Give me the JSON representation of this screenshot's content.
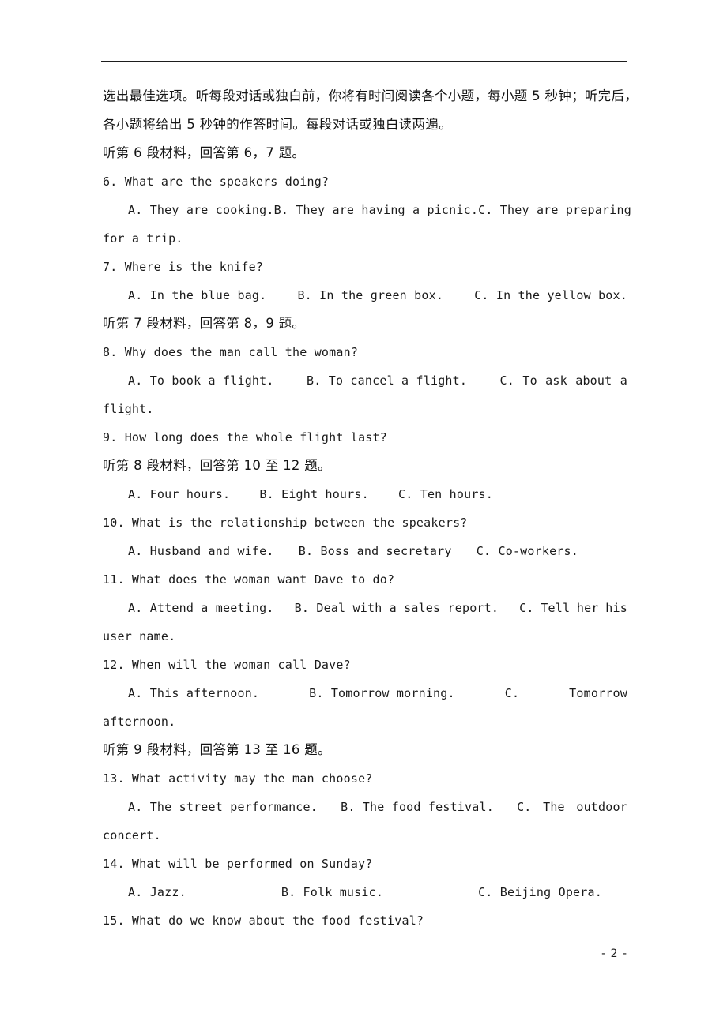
{
  "page": {
    "footer_page_number": "- 2 -",
    "rule_color": "#1d1d1d"
  },
  "instructions": {
    "line1_left": "选出最佳选项。听每段对话或独白前，你将有时间阅读各个小题，每小题 5 秒钟；听完后，",
    "line2": "各小题将给出 5 秒钟的作答时间。每段对话或独白读两遍。"
  },
  "sections": [
    {
      "id": "sec6",
      "label": "听第 6 段材料，回答第 6，7 题。"
    },
    {
      "id": "sec7",
      "label": "听第 7 段材料，回答第 8，9 题。"
    },
    {
      "id": "sec8",
      "label": "听第 8 段材料，回答第 10 至 12 题。"
    },
    {
      "id": "sec9",
      "label": "听第 9 段材料，回答第 13 至 16 题。"
    }
  ],
  "questions": {
    "q6": {
      "stem": "6. What are the speakers doing?",
      "a": "A. They are cooking.",
      "b": "B. They are having a picnic.",
      "c": "C. They are preparing",
      "c_wrap": "for a trip."
    },
    "q7": {
      "stem": "7. Where is the knife?",
      "a": "A. In the blue bag.",
      "b": "B. In the green box.",
      "c": "C. In the yellow box."
    },
    "q8": {
      "stem": "8. Why does the man call the woman?",
      "a": "A. To book a flight.",
      "b": "B. To cancel a flight.",
      "c_parts": [
        "C.",
        "To",
        "ask",
        "about",
        "a"
      ],
      "c_wrap": "flight."
    },
    "q9": {
      "stem": "9. How long does the whole flight last?",
      "a": "A. Four hours.",
      "b": "B. Eight hours.",
      "c": "C. Ten hours."
    },
    "q10": {
      "stem": "10. What is the relationship between the speakers?",
      "a": "A. Husband and wife.",
      "b": "B. Boss and secretary",
      "c": "C. Co-workers."
    },
    "q11": {
      "stem": "11. What does the woman want Dave to do?",
      "a": "A. Attend a meeting.",
      "b": "B. Deal with a sales report.",
      "c_parts": [
        "C.",
        "Tell",
        "her",
        "his"
      ],
      "c_wrap": "user name."
    },
    "q12": {
      "stem": "12. When will the woman call Dave?",
      "a": "A. This afternoon.",
      "b": "B. Tomorrow morning.",
      "c_label": "C.",
      "c_text": "Tomorrow",
      "c_wrap": "afternoon."
    },
    "q13": {
      "stem": "13. What activity may the man choose?",
      "a": "A. The street performance.",
      "b": "B. The food festival.",
      "c_parts": [
        "C.",
        "The",
        "outdoor"
      ],
      "c_wrap": "concert."
    },
    "q14": {
      "stem": "14. What will be performed on Sunday?",
      "a": "A. Jazz.",
      "b": "B. Folk music.",
      "c": "C. Beijing Opera."
    },
    "q15": {
      "stem": "15. What do we know about the food festival?"
    }
  }
}
